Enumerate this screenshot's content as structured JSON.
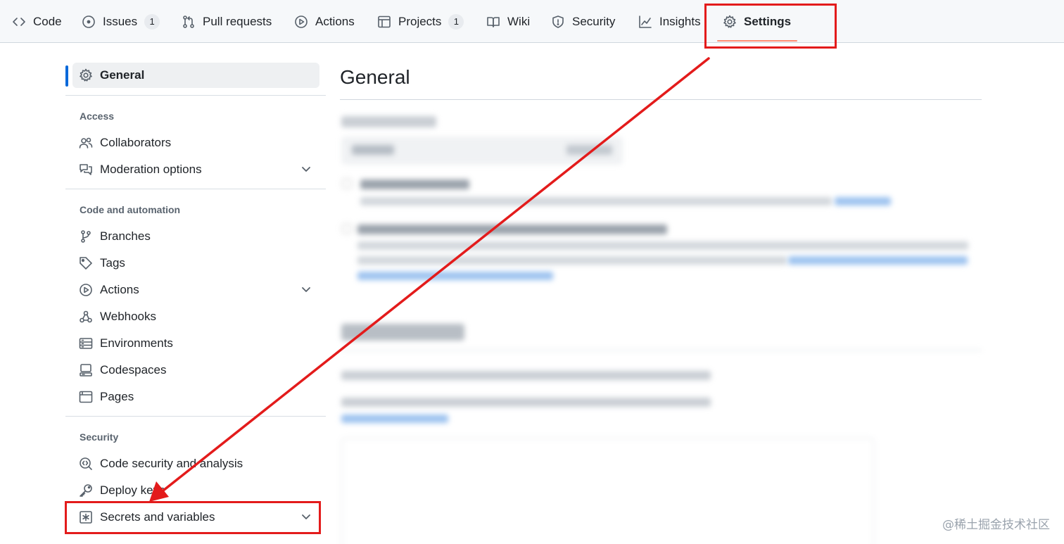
{
  "topnav": {
    "tabs": [
      {
        "label": "Code",
        "icon": "code-icon"
      },
      {
        "label": "Issues",
        "icon": "issue-opened-icon",
        "count": "1"
      },
      {
        "label": "Pull requests",
        "icon": "git-pull-request-icon"
      },
      {
        "label": "Actions",
        "icon": "play-icon"
      },
      {
        "label": "Projects",
        "icon": "table-icon",
        "count": "1"
      },
      {
        "label": "Wiki",
        "icon": "book-icon"
      },
      {
        "label": "Security",
        "icon": "shield-icon"
      },
      {
        "label": "Insights",
        "icon": "graph-icon"
      },
      {
        "label": "Settings",
        "icon": "gear-icon",
        "active": true
      }
    ],
    "active_underline_color": "#fd8c73"
  },
  "sidebar": {
    "general": {
      "label": "General",
      "icon": "gear-icon"
    },
    "groups": [
      {
        "heading": "Access",
        "items": [
          {
            "label": "Collaborators",
            "icon": "people-icon"
          },
          {
            "label": "Moderation options",
            "icon": "comment-discussion-icon",
            "expandable": true
          }
        ]
      },
      {
        "heading": "Code and automation",
        "items": [
          {
            "label": "Branches",
            "icon": "git-branch-icon"
          },
          {
            "label": "Tags",
            "icon": "tag-icon"
          },
          {
            "label": "Actions",
            "icon": "play-icon",
            "expandable": true
          },
          {
            "label": "Webhooks",
            "icon": "webhook-icon"
          },
          {
            "label": "Environments",
            "icon": "server-icon"
          },
          {
            "label": "Codespaces",
            "icon": "codespaces-icon"
          },
          {
            "label": "Pages",
            "icon": "browser-icon"
          }
        ]
      },
      {
        "heading": "Security",
        "items": [
          {
            "label": "Code security and analysis",
            "icon": "codescan-icon"
          },
          {
            "label": "Deploy keys",
            "icon": "key-icon"
          },
          {
            "label": "Secrets and variables",
            "icon": "key-asterisk-icon",
            "expandable": true
          }
        ]
      }
    ],
    "active_color": "#0969da"
  },
  "main": {
    "title": "General"
  },
  "annotations": {
    "highlight_color": "#e31b1b",
    "arrow": {
      "from": "tab-settings",
      "to": "sidebar-item-secrets-and-variables"
    }
  },
  "watermark": "@稀土掘金技术社区"
}
